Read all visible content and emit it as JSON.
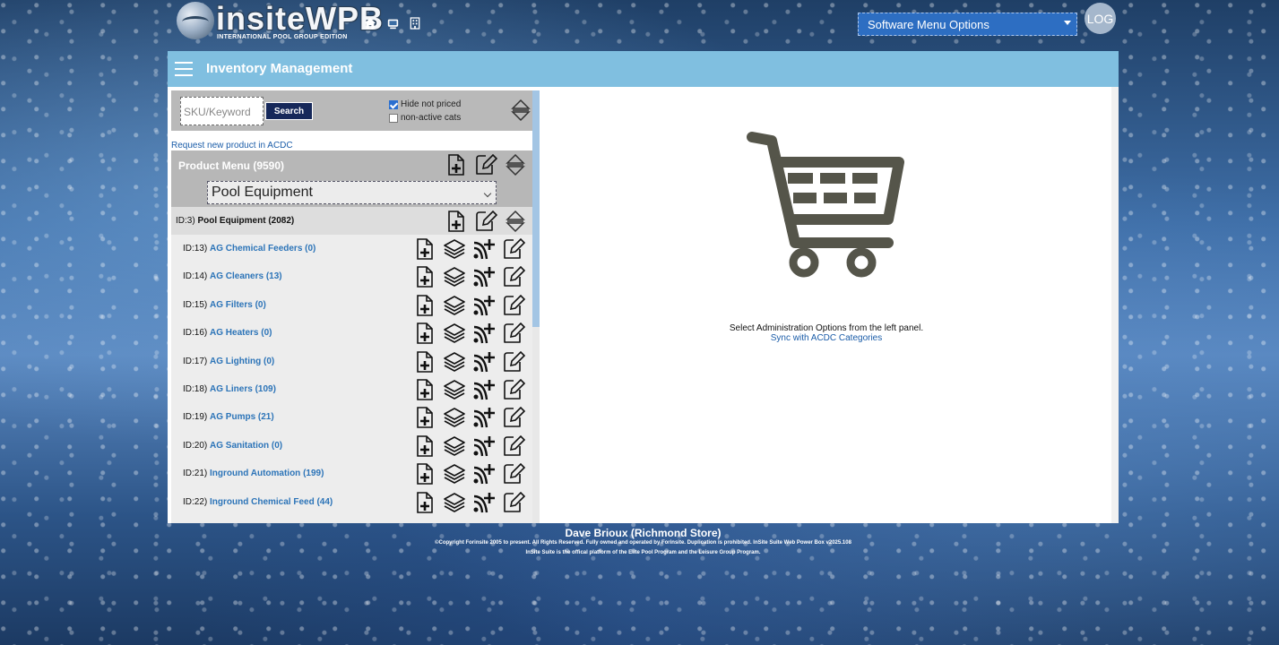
{
  "brand": {
    "name": "insiteWPB",
    "subtitle": "INTERNATIONAL POOL GROUP EDITION"
  },
  "top_icons": [
    "home-icon",
    "monitor-icon",
    "building-icon"
  ],
  "software_menu": {
    "selected": "Software Menu Options"
  },
  "log_button": "LOG",
  "header": {
    "title": "Inventory Management"
  },
  "search": {
    "placeholder": "SKU/Keyword",
    "button_label": "Search",
    "hide_not_priced": {
      "label": "Hide not priced",
      "checked": true
    },
    "non_active_cats": {
      "label": "non-active cats",
      "checked": false
    }
  },
  "request_link": "Request new product in ACDC",
  "product_menu": {
    "title": "Product Menu (9590)",
    "selected": "Pool Equipment"
  },
  "category_header": {
    "id": "ID:3)",
    "name": "Pool Equipment (2082)"
  },
  "categories": [
    {
      "id": "ID:13)",
      "name": "AG Chemical Feeders (0)"
    },
    {
      "id": "ID:14)",
      "name": "AG Cleaners (13)"
    },
    {
      "id": "ID:15)",
      "name": "AG Filters (0)"
    },
    {
      "id": "ID:16)",
      "name": "AG Heaters (0)"
    },
    {
      "id": "ID:17)",
      "name": "AG Lighting (0)"
    },
    {
      "id": "ID:18)",
      "name": "AG Liners (109)"
    },
    {
      "id": "ID:19)",
      "name": "AG Pumps (21)"
    },
    {
      "id": "ID:20)",
      "name": "AG Sanitation (0)"
    },
    {
      "id": "ID:21)",
      "name": "Inground Automation (199)"
    },
    {
      "id": "ID:22)",
      "name": "Inground Chemical Feed (44)"
    }
  ],
  "right_panel": {
    "icon": "shopping-cart-icon",
    "message": "Select Administration Options from the left panel.",
    "sync_link": "Sync with ACDC Categories"
  },
  "footer": {
    "user": "Dave Brioux (Richmond Store)",
    "copyright": "©Copyright Forinsite 2005 to present. All Rights Reserved. Fully owned and operated by Forinsite. Duplication is prohibited. InSite Suite Web Power Box v2025.108",
    "program": "InSite Suite is the offical platform of the Elite Pool Program and the Leisure Group Program."
  },
  "colors": {
    "header_bg": "#80bfe0",
    "menu_select_bg": "#2d6ec2",
    "search_button_bg": "#16285a",
    "link": "#2c74b8",
    "cart": "#55554a"
  }
}
